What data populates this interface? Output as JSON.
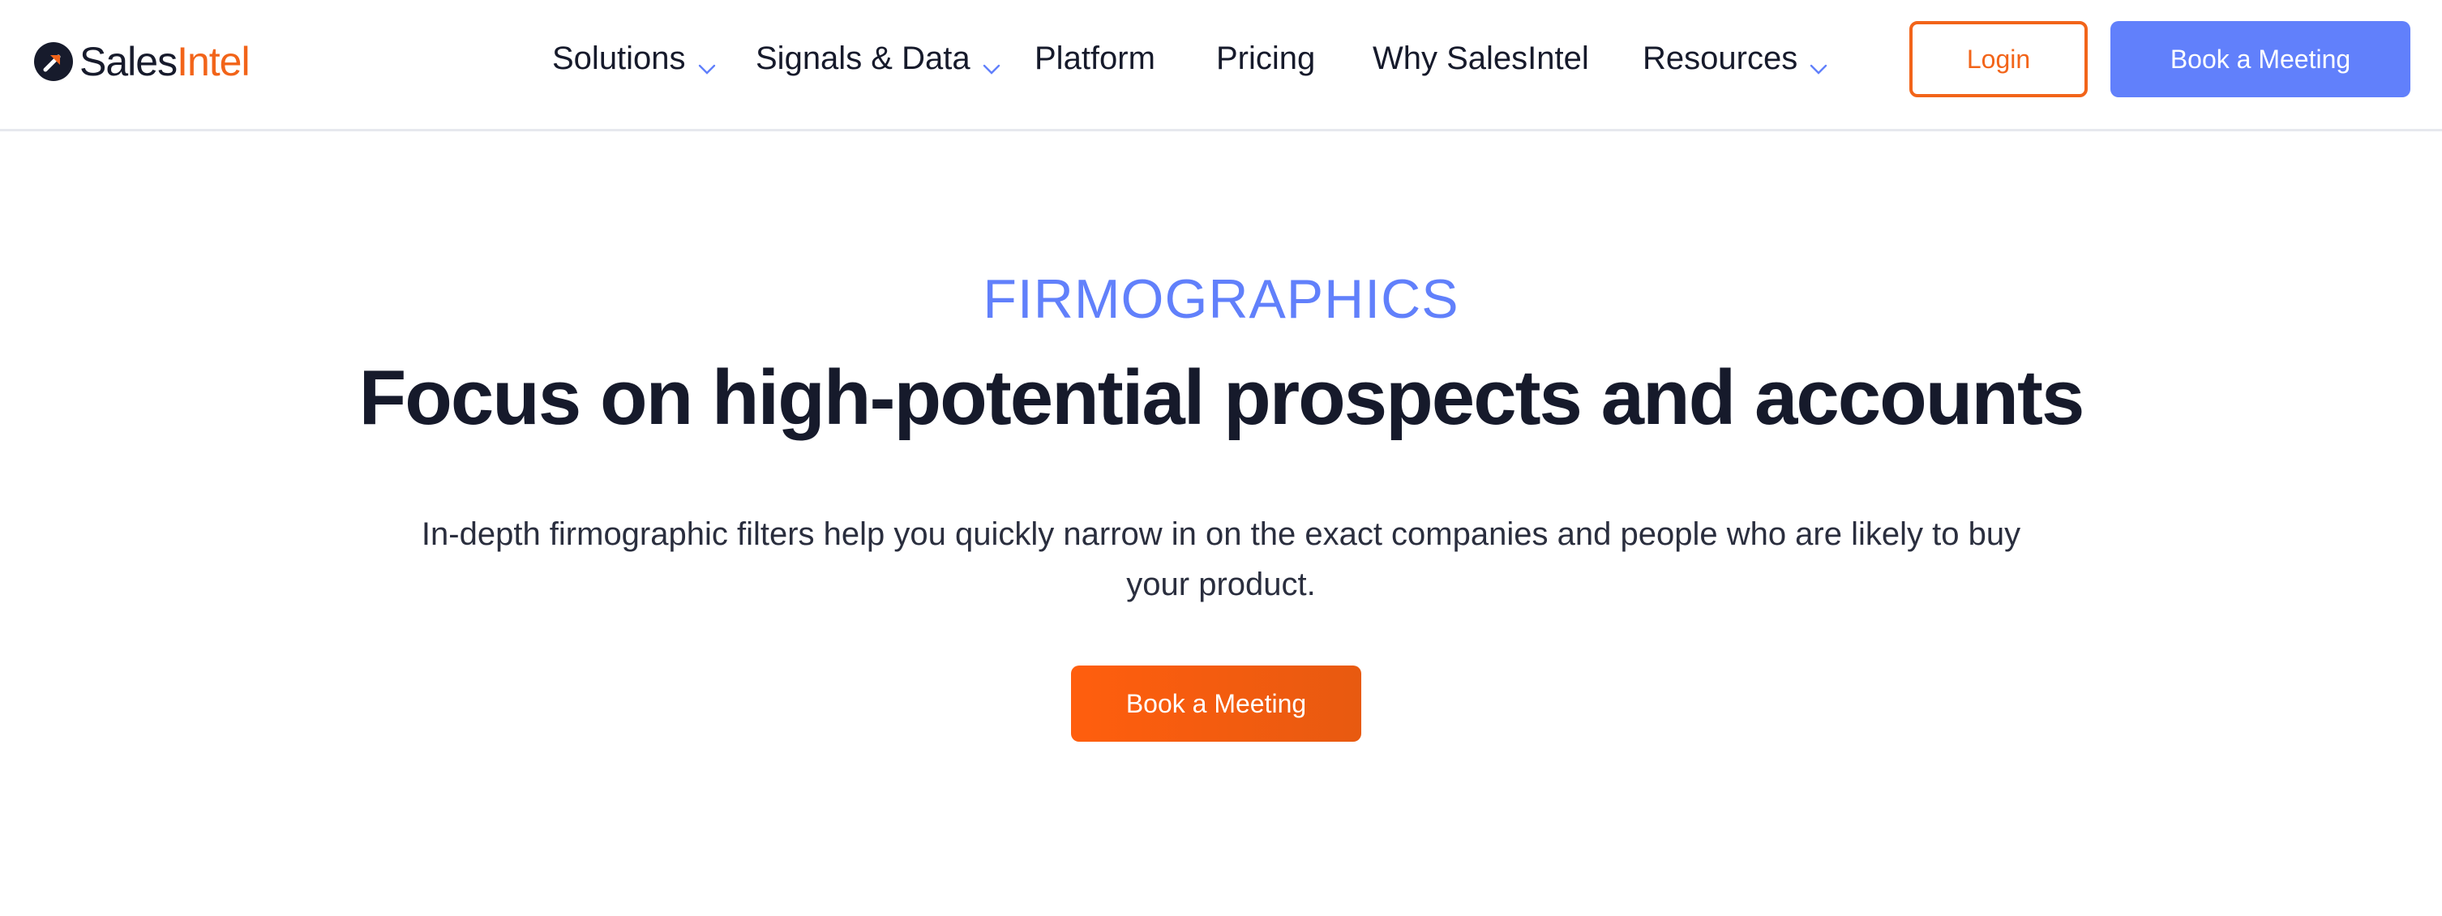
{
  "brand": {
    "name_part1": "Sales",
    "name_part2": "Intel",
    "colors": {
      "dark": "#171b2c",
      "orange": "#f26419",
      "blue": "#6180fb"
    }
  },
  "nav": {
    "items": [
      {
        "label": "Solutions",
        "has_dropdown": true
      },
      {
        "label": "Signals & Data",
        "has_dropdown": true
      },
      {
        "label": "Platform",
        "has_dropdown": false
      },
      {
        "label": "Pricing",
        "has_dropdown": false
      },
      {
        "label": "Why SalesIntel",
        "has_dropdown": false
      },
      {
        "label": "Resources",
        "has_dropdown": true
      }
    ],
    "login_label": "Login",
    "book_label": "Book a Meeting"
  },
  "hero": {
    "eyebrow": "FIRMOGRAPHICS",
    "headline": "Focus on high-potential prospects and accounts",
    "subtext": "In-depth firmographic filters help you quickly narrow in on the exact companies and people who are likely to buy your product.",
    "cta_label": "Book a Meeting"
  },
  "icons": {
    "logo": "salesintel-arrow-logo-icon",
    "dropdown": "chevron-down-icon"
  }
}
